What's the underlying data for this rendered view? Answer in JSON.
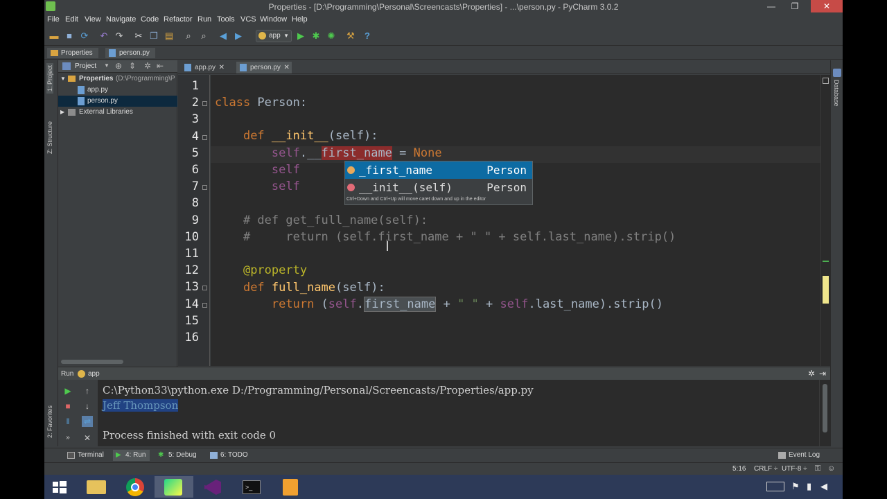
{
  "window": {
    "title": "Properties - [D:\\Programming\\Personal\\Screencasts\\Properties] - ...\\person.py - PyCharm 3.0.2",
    "minimize": "—",
    "maximize": "❐",
    "close": "✕"
  },
  "menu": [
    "File",
    "Edit",
    "View",
    "Navigate",
    "Code",
    "Refactor",
    "Run",
    "Tools",
    "VCS",
    "Window",
    "Help"
  ],
  "toolbar": {
    "run_config": "app",
    "icons": [
      "open-folder-icon",
      "save-icon",
      "sync-icon",
      "undo-icon",
      "redo-icon",
      "cut-icon",
      "copy-icon",
      "paste-icon",
      "find-icon",
      "replace-icon",
      "back-icon",
      "forward-icon",
      "run-config-icon",
      "run-icon",
      "debug-icon",
      "coverage-icon",
      "settings-icon",
      "help-icon"
    ]
  },
  "breadcrumb": [
    "Properties",
    "person.py"
  ],
  "left_strip": {
    "project": "1: Project",
    "structure": "Z: Structure",
    "favorites": "2: Favorites"
  },
  "right_strip": {
    "database": "Database"
  },
  "project_panel": {
    "title": "Project",
    "tree": [
      {
        "label": "Properties",
        "suffix": "(D:\\Programming\\P",
        "type": "folder",
        "expanded": true
      },
      {
        "label": "app.py",
        "type": "py"
      },
      {
        "label": "person.py",
        "type": "py",
        "selected": true
      },
      {
        "label": "External Libraries",
        "type": "lib",
        "expanded": false
      }
    ]
  },
  "editor_tabs": [
    {
      "label": "app.py",
      "active": false
    },
    {
      "label": "person.py",
      "active": true
    }
  ],
  "editor": {
    "line_numbers": [
      "1",
      "2",
      "3",
      "4",
      "5",
      "6",
      "7",
      "8",
      "9",
      "10",
      "11",
      "12",
      "13",
      "14",
      "15",
      "16"
    ],
    "lines": [
      "",
      "class Person:",
      "",
      "    def __init__(self):",
      "        self.__first_name = None",
      "        self",
      "        self",
      "",
      "    # def get_full_name(self):",
      "    #     return (self.first_name + \" \" + self.last_name).strip()",
      "",
      "    @property",
      "    def full_name(self):",
      "        return (self.first_name + \" \" + self.last_name).strip()",
      "",
      ""
    ],
    "tokens": {
      "class": "class",
      "person": " Person:",
      "def": "def",
      "init": " __init__",
      "self_arg": "(self):",
      "self": "self",
      "dot_us": ".__",
      "first_name": "first_name",
      "eq_none": " = ",
      "none": "None",
      "comment_def": "# def get_full_name(self):",
      "comment_return": "#     return (self.first_name + \" \" + self.last_name).strip()",
      "decorator": "@property",
      "full_name": " full_name",
      "return": "return",
      "paren": " (",
      "dot": ".",
      "concat": " + ",
      "space_str": "\" \"",
      "last_name_strip": ".last_name).strip()"
    }
  },
  "completion": {
    "items": [
      {
        "name": "_first_name",
        "type": "Person",
        "selected": true,
        "color": "#e8a95b"
      },
      {
        "name": "__init__(self)",
        "type": "Person",
        "selected": false,
        "color": "#e36b77"
      }
    ],
    "hint": "Ctrl+Down and Ctrl+Up will move caret down and up in the editor"
  },
  "run_panel": {
    "label": "Run",
    "config": "app",
    "console": [
      "C:\\Python33\\python.exe D:/Programming/Personal/Screencasts/Properties/app.py",
      "Jeff Thompson",
      "",
      "Process finished with exit code 0"
    ]
  },
  "tool_tabs": [
    {
      "label": "Terminal",
      "active": false
    },
    {
      "label": "4: Run",
      "active": true
    },
    {
      "label": "5: Debug",
      "active": false
    },
    {
      "label": "6: TODO",
      "active": false
    }
  ],
  "event_log": "Event Log",
  "status": {
    "position": "5:16",
    "line_sep": "CRLF ÷",
    "encoding": "UTF-8 ÷"
  },
  "colors": {
    "editor_bg": "#2b2b2b",
    "keyword": "#cc7832",
    "self": "#94558d",
    "decorator": "#bbb529",
    "comment": "#808080",
    "string": "#6a8759",
    "selection": "#0d6ba3"
  }
}
